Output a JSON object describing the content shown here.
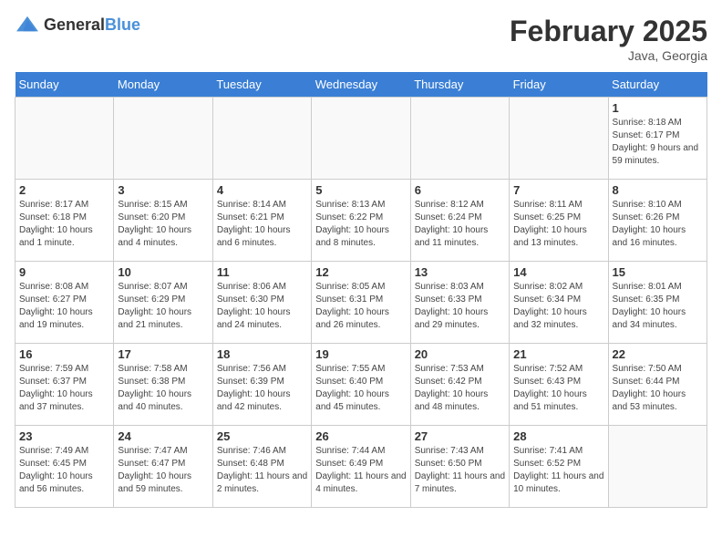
{
  "header": {
    "logo_general": "General",
    "logo_blue": "Blue",
    "month_year": "February 2025",
    "location": "Java, Georgia"
  },
  "days_of_week": [
    "Sunday",
    "Monday",
    "Tuesday",
    "Wednesday",
    "Thursday",
    "Friday",
    "Saturday"
  ],
  "weeks": [
    [
      {
        "day": "",
        "info": ""
      },
      {
        "day": "",
        "info": ""
      },
      {
        "day": "",
        "info": ""
      },
      {
        "day": "",
        "info": ""
      },
      {
        "day": "",
        "info": ""
      },
      {
        "day": "",
        "info": ""
      },
      {
        "day": "1",
        "info": "Sunrise: 8:18 AM\nSunset: 6:17 PM\nDaylight: 9 hours and 59 minutes."
      }
    ],
    [
      {
        "day": "2",
        "info": "Sunrise: 8:17 AM\nSunset: 6:18 PM\nDaylight: 10 hours and 1 minute."
      },
      {
        "day": "3",
        "info": "Sunrise: 8:15 AM\nSunset: 6:20 PM\nDaylight: 10 hours and 4 minutes."
      },
      {
        "day": "4",
        "info": "Sunrise: 8:14 AM\nSunset: 6:21 PM\nDaylight: 10 hours and 6 minutes."
      },
      {
        "day": "5",
        "info": "Sunrise: 8:13 AM\nSunset: 6:22 PM\nDaylight: 10 hours and 8 minutes."
      },
      {
        "day": "6",
        "info": "Sunrise: 8:12 AM\nSunset: 6:24 PM\nDaylight: 10 hours and 11 minutes."
      },
      {
        "day": "7",
        "info": "Sunrise: 8:11 AM\nSunset: 6:25 PM\nDaylight: 10 hours and 13 minutes."
      },
      {
        "day": "8",
        "info": "Sunrise: 8:10 AM\nSunset: 6:26 PM\nDaylight: 10 hours and 16 minutes."
      }
    ],
    [
      {
        "day": "9",
        "info": "Sunrise: 8:08 AM\nSunset: 6:27 PM\nDaylight: 10 hours and 19 minutes."
      },
      {
        "day": "10",
        "info": "Sunrise: 8:07 AM\nSunset: 6:29 PM\nDaylight: 10 hours and 21 minutes."
      },
      {
        "day": "11",
        "info": "Sunrise: 8:06 AM\nSunset: 6:30 PM\nDaylight: 10 hours and 24 minutes."
      },
      {
        "day": "12",
        "info": "Sunrise: 8:05 AM\nSunset: 6:31 PM\nDaylight: 10 hours and 26 minutes."
      },
      {
        "day": "13",
        "info": "Sunrise: 8:03 AM\nSunset: 6:33 PM\nDaylight: 10 hours and 29 minutes."
      },
      {
        "day": "14",
        "info": "Sunrise: 8:02 AM\nSunset: 6:34 PM\nDaylight: 10 hours and 32 minutes."
      },
      {
        "day": "15",
        "info": "Sunrise: 8:01 AM\nSunset: 6:35 PM\nDaylight: 10 hours and 34 minutes."
      }
    ],
    [
      {
        "day": "16",
        "info": "Sunrise: 7:59 AM\nSunset: 6:37 PM\nDaylight: 10 hours and 37 minutes."
      },
      {
        "day": "17",
        "info": "Sunrise: 7:58 AM\nSunset: 6:38 PM\nDaylight: 10 hours and 40 minutes."
      },
      {
        "day": "18",
        "info": "Sunrise: 7:56 AM\nSunset: 6:39 PM\nDaylight: 10 hours and 42 minutes."
      },
      {
        "day": "19",
        "info": "Sunrise: 7:55 AM\nSunset: 6:40 PM\nDaylight: 10 hours and 45 minutes."
      },
      {
        "day": "20",
        "info": "Sunrise: 7:53 AM\nSunset: 6:42 PM\nDaylight: 10 hours and 48 minutes."
      },
      {
        "day": "21",
        "info": "Sunrise: 7:52 AM\nSunset: 6:43 PM\nDaylight: 10 hours and 51 minutes."
      },
      {
        "day": "22",
        "info": "Sunrise: 7:50 AM\nSunset: 6:44 PM\nDaylight: 10 hours and 53 minutes."
      }
    ],
    [
      {
        "day": "23",
        "info": "Sunrise: 7:49 AM\nSunset: 6:45 PM\nDaylight: 10 hours and 56 minutes."
      },
      {
        "day": "24",
        "info": "Sunrise: 7:47 AM\nSunset: 6:47 PM\nDaylight: 10 hours and 59 minutes."
      },
      {
        "day": "25",
        "info": "Sunrise: 7:46 AM\nSunset: 6:48 PM\nDaylight: 11 hours and 2 minutes."
      },
      {
        "day": "26",
        "info": "Sunrise: 7:44 AM\nSunset: 6:49 PM\nDaylight: 11 hours and 4 minutes."
      },
      {
        "day": "27",
        "info": "Sunrise: 7:43 AM\nSunset: 6:50 PM\nDaylight: 11 hours and 7 minutes."
      },
      {
        "day": "28",
        "info": "Sunrise: 7:41 AM\nSunset: 6:52 PM\nDaylight: 11 hours and 10 minutes."
      },
      {
        "day": "",
        "info": ""
      }
    ]
  ]
}
